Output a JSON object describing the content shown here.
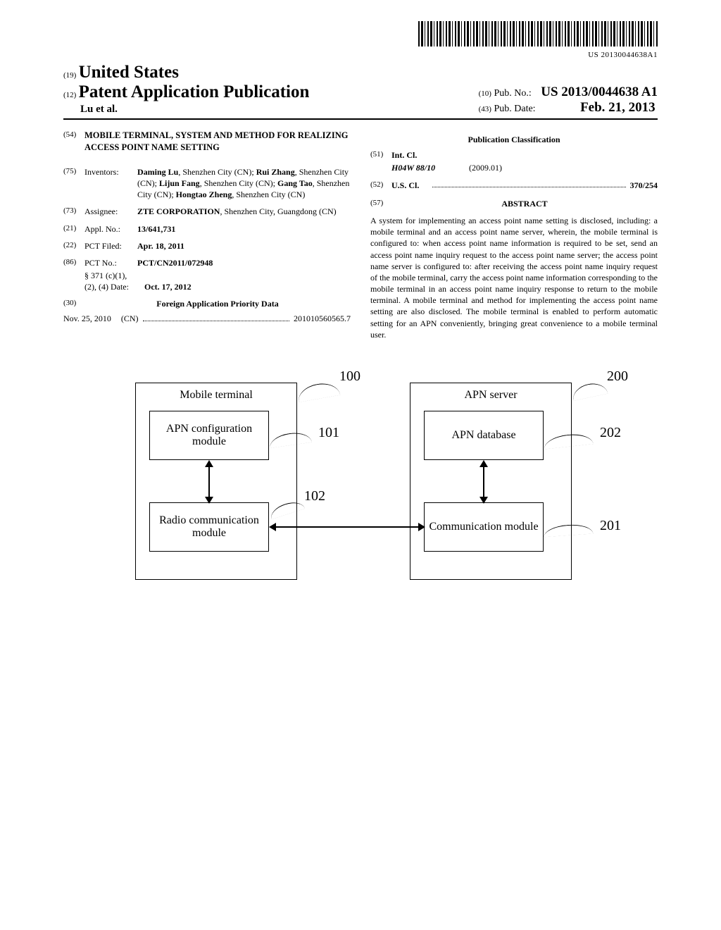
{
  "barcode_label": "US 20130044638A1",
  "header": {
    "country_code": "(19)",
    "country": "United States",
    "pub_type_code": "(12)",
    "pub_type": "Patent Application Publication",
    "authors": "Lu et al.",
    "pub_no_code": "(10)",
    "pub_no_label": "Pub. No.:",
    "pub_no": "US 2013/0044638 A1",
    "pub_date_code": "(43)",
    "pub_date_label": "Pub. Date:",
    "pub_date": "Feb. 21, 2013"
  },
  "left": {
    "title_code": "(54)",
    "title": "MOBILE TERMINAL, SYSTEM AND METHOD FOR REALIZING ACCESS POINT NAME SETTING",
    "inventors_code": "(75)",
    "inventors_label": "Inventors:",
    "inventors_value": "Daming Lu, Shenzhen City (CN); Rui Zhang, Shenzhen City (CN); Lijun Fang, Shenzhen City (CN); Gang Tao, Shenzhen City (CN); Hongtao Zheng, Shenzhen City (CN)",
    "assignee_code": "(73)",
    "assignee_label": "Assignee:",
    "assignee_value": "ZTE CORPORATION, Shenzhen City, Guangdong (CN)",
    "appl_code": "(21)",
    "appl_label": "Appl. No.:",
    "appl_value": "13/641,731",
    "filed_code": "(22)",
    "filed_label": "PCT Filed:",
    "filed_value": "Apr. 18, 2011",
    "pct_code": "(86)",
    "pct_label": "PCT No.:",
    "pct_value": "PCT/CN2011/072948",
    "s371_label": "§ 371 (c)(1),",
    "s371_line2": "(2), (4) Date:",
    "s371_value": "Oct. 17, 2012",
    "foreign_code": "(30)",
    "foreign_title": "Foreign Application Priority Data",
    "foreign_date": "Nov. 25, 2010",
    "foreign_country": "(CN)",
    "foreign_no": "201010560565.7"
  },
  "right": {
    "pub_class_title": "Publication Classification",
    "intcl_code": "(51)",
    "intcl_label": "Int. Cl.",
    "intcl_class": "H04W 88/10",
    "intcl_year": "(2009.01)",
    "uscl_code": "(52)",
    "uscl_label": "U.S. Cl.",
    "uscl_value": "370/254",
    "abstract_code": "(57)",
    "abstract_title": "ABSTRACT",
    "abstract_text": "A system for implementing an access point name setting is disclosed, including: a mobile terminal and an access point name server, wherein, the mobile terminal is configured to: when access point name information is required to be set, send an access point name inquiry request to the access point name server; the access point name server is configured to: after receiving the access point name inquiry request of the mobile terminal, carry the access point name information corresponding to the mobile terminal in an access point name inquiry response to return to the mobile terminal. A mobile terminal and method for implementing the access point name setting are also disclosed. The mobile terminal is enabled to perform automatic setting for an APN conveniently, bringing great convenience to a mobile terminal user."
  },
  "diagram": {
    "mobile_terminal": "Mobile terminal",
    "apn_config": "APN configuration module",
    "radio_comm": "Radio communication module",
    "apn_server": "APN server",
    "apn_database": "APN database",
    "comm_module": "Communication module",
    "n100": "100",
    "n101": "101",
    "n102": "102",
    "n200": "200",
    "n201": "201",
    "n202": "202"
  }
}
